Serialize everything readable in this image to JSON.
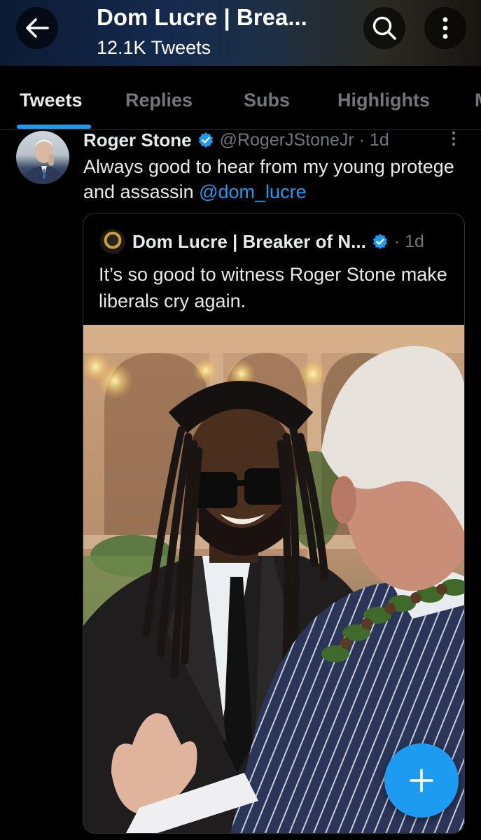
{
  "header": {
    "title": "Dom Lucre | Brea...",
    "subtitle": "12.1K Tweets",
    "back_icon": "arrow-left-icon",
    "search_icon": "search-icon",
    "more_icon": "vertical-ellipsis-icon",
    "background_color": "#152a4e"
  },
  "tabs": [
    {
      "label": "Tweets",
      "active": true
    },
    {
      "label": "Replies",
      "active": false
    },
    {
      "label": "Subs",
      "active": false
    },
    {
      "label": "Highlights",
      "active": false
    },
    {
      "label": "M",
      "active": false
    }
  ],
  "tweet": {
    "author_name": "Roger Stone",
    "handle": "@RogerJStoneJr · 1d",
    "text": "Always good to hear from my young protege and assassin ",
    "mention": "@dom_lucre",
    "verified_icon": "verified-badge-icon",
    "more_icon": "vertical-ellipsis-icon"
  },
  "quoted_tweet": {
    "author_name": "Dom Lucre | Breaker of N...",
    "timestamp": "· 1d",
    "text": "It’s so good to witness Roger Stone make liberals cry again.",
    "verified_icon": "verified-badge-icon",
    "photo": "photo-of-two-men-talking-at-evening-event"
  },
  "fab": {
    "icon": "plus-icon"
  },
  "colors": {
    "accent": "#1d9bf0",
    "background": "#000000",
    "text_primary": "#e7e9ea",
    "text_secondary": "#71767b",
    "border": "#2f3336"
  }
}
